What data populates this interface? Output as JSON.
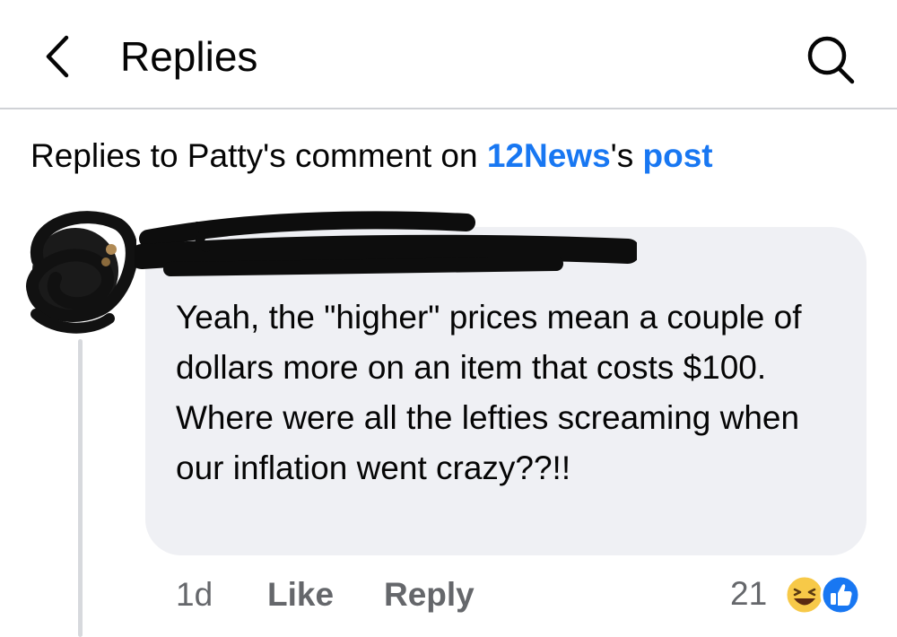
{
  "header": {
    "title": "Replies",
    "back_icon": "chevron-left-icon",
    "search_icon": "search-icon"
  },
  "context": {
    "prefix": "Replies to Patty's comment on ",
    "page_name": "12News",
    "possessive": "'s ",
    "post_link": "post"
  },
  "comment": {
    "text": "Yeah, the \"higher\" prices mean a couple of dollars more on an item that costs $100.  Where were all the lefties screaming when our inflation went crazy??!!",
    "time": "1d",
    "like_label": "Like",
    "reply_label": "Reply",
    "reaction_count": "21",
    "reaction_icons": [
      "haha-icon",
      "like-icon"
    ]
  },
  "colors": {
    "link": "#1877f2",
    "bubble": "#eff0f4",
    "secondary_text": "#65676b",
    "divider": "#d0d2d6"
  }
}
